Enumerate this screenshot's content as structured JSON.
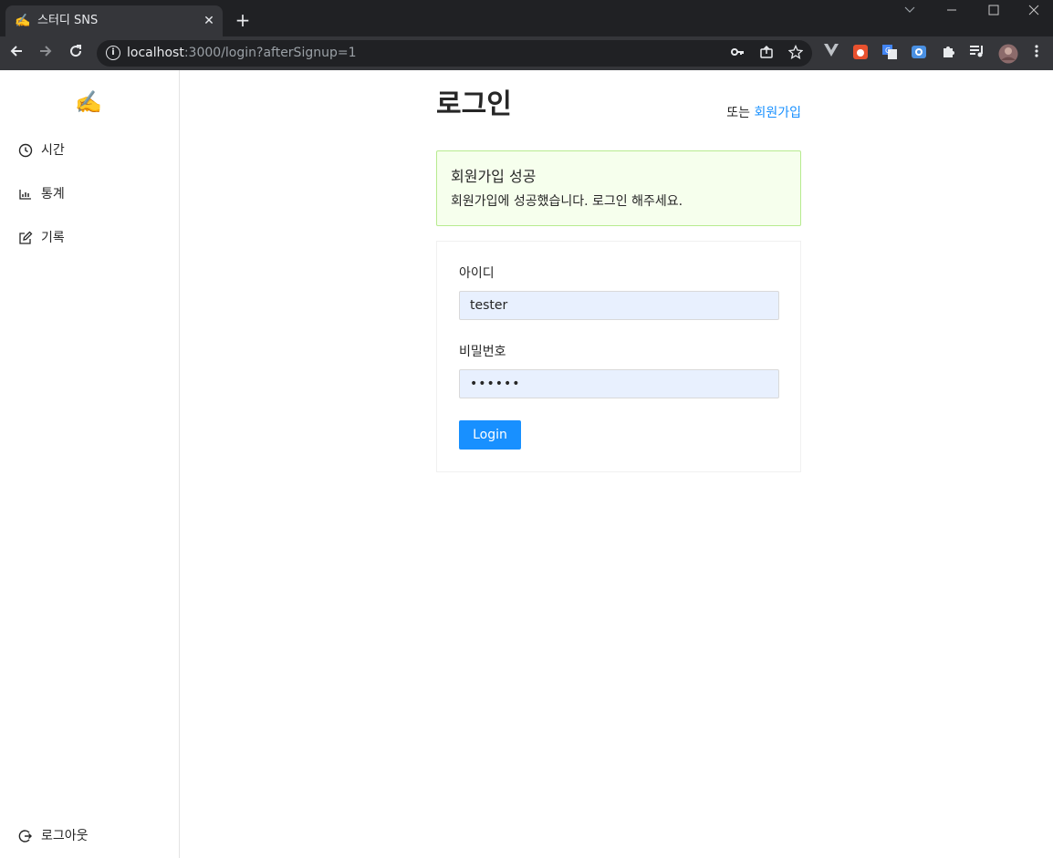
{
  "browser": {
    "tab_title": "스터디 SNS",
    "tab_favicon": "writing-hand-icon",
    "url_host": "localhost",
    "url_rest": ":3000/login?afterSignup=1"
  },
  "sidebar": {
    "logo": "writing-hand-icon",
    "items": [
      {
        "label": "시간",
        "icon": "clock-icon"
      },
      {
        "label": "통계",
        "icon": "bar-chart-icon"
      },
      {
        "label": "기록",
        "icon": "edit-icon"
      }
    ],
    "logout": {
      "label": "로그아웃",
      "icon": "logout-icon"
    }
  },
  "main": {
    "title": "로그인",
    "signup_prefix": "또는",
    "signup_link": "회원가입",
    "alert": {
      "title": "회원가입 성공",
      "description": "회원가입에 성공했습니다. 로그인 해주세요.",
      "color": "#b7eb8f"
    },
    "form": {
      "id_label": "아이디",
      "id_value": "tester",
      "password_label": "비밀번호",
      "password_value": "••••••",
      "submit_label": "Login"
    }
  },
  "colors": {
    "primary": "#1890ff",
    "success_bg": "#f6ffed",
    "autofill_bg": "#e8f0fe"
  }
}
